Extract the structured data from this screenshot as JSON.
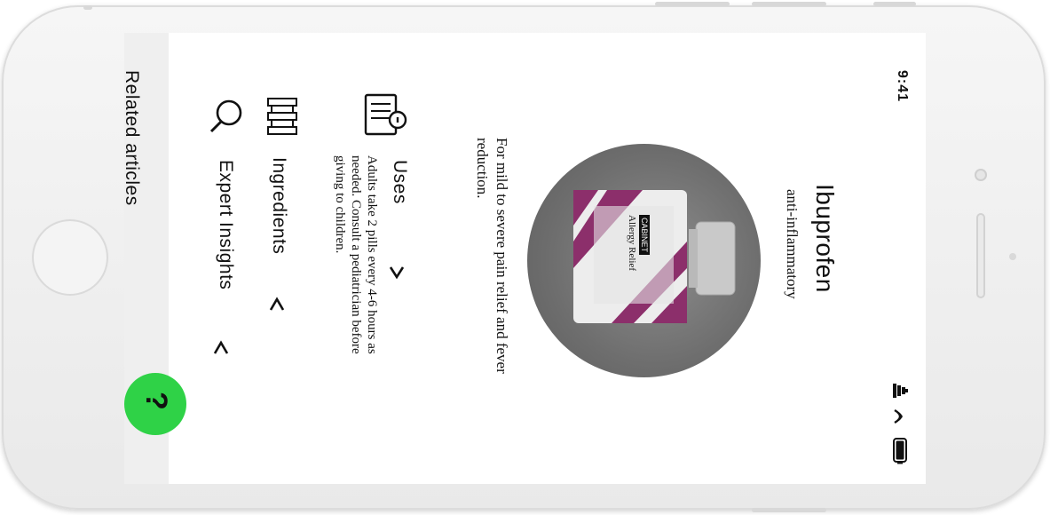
{
  "status_bar": {
    "time": "9:41",
    "icons": [
      "signal-icon",
      "wifi-icon",
      "battery-icon"
    ]
  },
  "product": {
    "name": "Ibuprofen",
    "category": "anti-inflammatory",
    "description": "For mild to severe pain relief and fever reduction.",
    "image_label": {
      "brand": "CABINET",
      "name": "Allergy Relief"
    }
  },
  "sections": [
    {
      "title": "Uses",
      "body": "Adults take 2 pills every 4-6 hours as needed. Consult a pediatrician before giving to children.",
      "icon": "document-icon",
      "chevron": "chevron-down-icon"
    },
    {
      "title": "Ingredients",
      "icon": "bottles-icon",
      "chevron": "chevron-left-icon"
    },
    {
      "title": "Expert Insights",
      "icon": "search-icon",
      "chevron": "chevron-left-icon"
    }
  ],
  "related": {
    "label": "Related articles"
  },
  "help_button": {
    "symbol": "?",
    "color": "#2fd247"
  }
}
